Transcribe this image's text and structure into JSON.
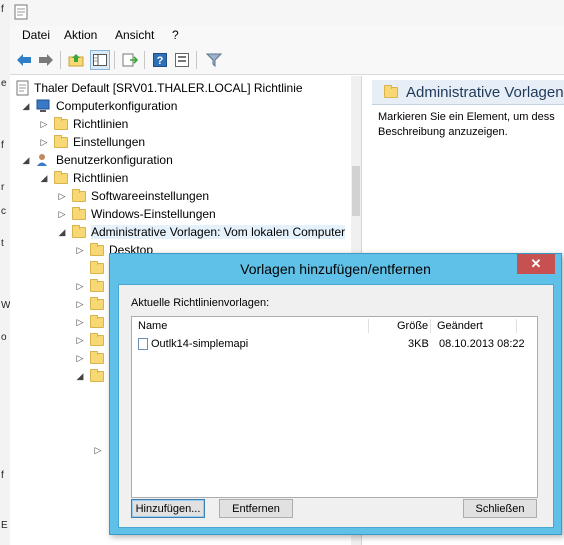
{
  "left_strip_chars": [
    "f",
    "e",
    "f",
    "r",
    "c",
    "t",
    "W",
    "o",
    "f",
    "E"
  ],
  "menu": [
    "Datei",
    "Aktion",
    "Ansicht",
    "?"
  ],
  "toolbar_icons": [
    "back-icon",
    "forward-icon",
    "up-folder-icon",
    "show-hide-tree-icon",
    "export-list-icon",
    "help-icon",
    "properties-icon",
    "filter-icon"
  ],
  "tree": {
    "root": "Thaler Default [SRV01.THALER.LOCAL] Richtlinie",
    "computer": "Computerkonfiguration",
    "computer_policies": "Richtlinien",
    "computer_settings": "Einstellungen",
    "user": "Benutzerkonfiguration",
    "user_policies": "Richtlinien",
    "software": "Softwareeinstellungen",
    "windows": "Windows-Einstellungen",
    "admin_templates": "Administrative Vorlagen: Vom lokalen Computer",
    "desktop": "Desktop"
  },
  "right_pane": {
    "title": "Administrative Vorlagen",
    "description": "Markieren Sie ein Element, um dess Beschreibung anzuzeigen."
  },
  "dialog": {
    "title": "Vorlagen hinzufügen/entfernen",
    "close": "✕",
    "list_label": "Aktuelle Richtlinienvorlagen:",
    "columns": {
      "name": "Name",
      "size": "Größe",
      "changed": "Geändert"
    },
    "rows": [
      {
        "name": "Outlk14-simplemapi",
        "size": "3KB",
        "changed": "08.10.2013 08:22"
      }
    ],
    "buttons": {
      "add": "Hinzufügen...",
      "remove": "Entfernen",
      "close": "Schließen"
    }
  }
}
